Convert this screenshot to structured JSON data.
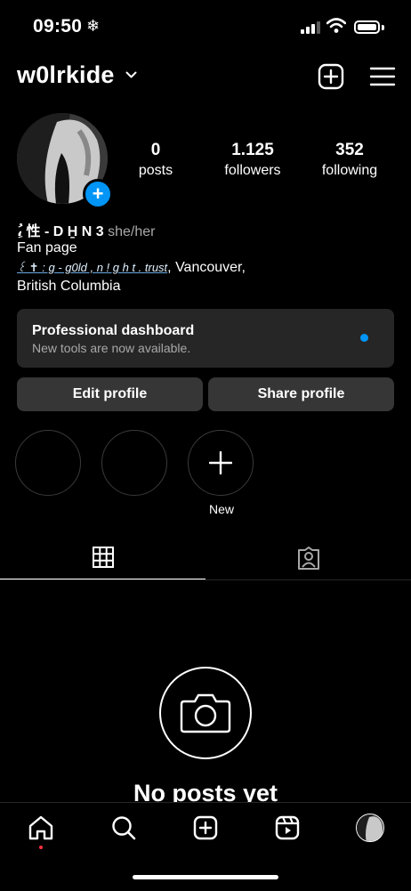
{
  "status": {
    "time": "09:50",
    "time_icon": "snowflake-icon",
    "snow_glyph": "❄"
  },
  "header": {
    "username": "w0lrkide",
    "icons": [
      "chevron-down-icon",
      "new-post-icon",
      "menu-icon"
    ]
  },
  "stats": [
    {
      "value": "0",
      "label": "posts"
    },
    {
      "value": "1.125",
      "label": "followers"
    },
    {
      "value": "352",
      "label": "following"
    }
  ],
  "bio": {
    "name": "ِ،ُ 性 - D H̱ N 3",
    "pronouns": "she/her",
    "category": "Fan page",
    "link": "꒰ ✝︎ : g - g0ld , n ! g h t . trust",
    "location_a": ", Vancouver,",
    "location_b": "British Columbia"
  },
  "dashboard": {
    "title": "Professional dashboard",
    "subtitle": "New tools are now available."
  },
  "buttons": {
    "edit": "Edit profile",
    "share": "Share profile"
  },
  "highlights": {
    "new_label": "New"
  },
  "empty": {
    "title": "No posts yet"
  },
  "colors": {
    "accent": "#0095f6",
    "surface": "#262626",
    "button": "#363636",
    "notif": "#ff3040"
  }
}
